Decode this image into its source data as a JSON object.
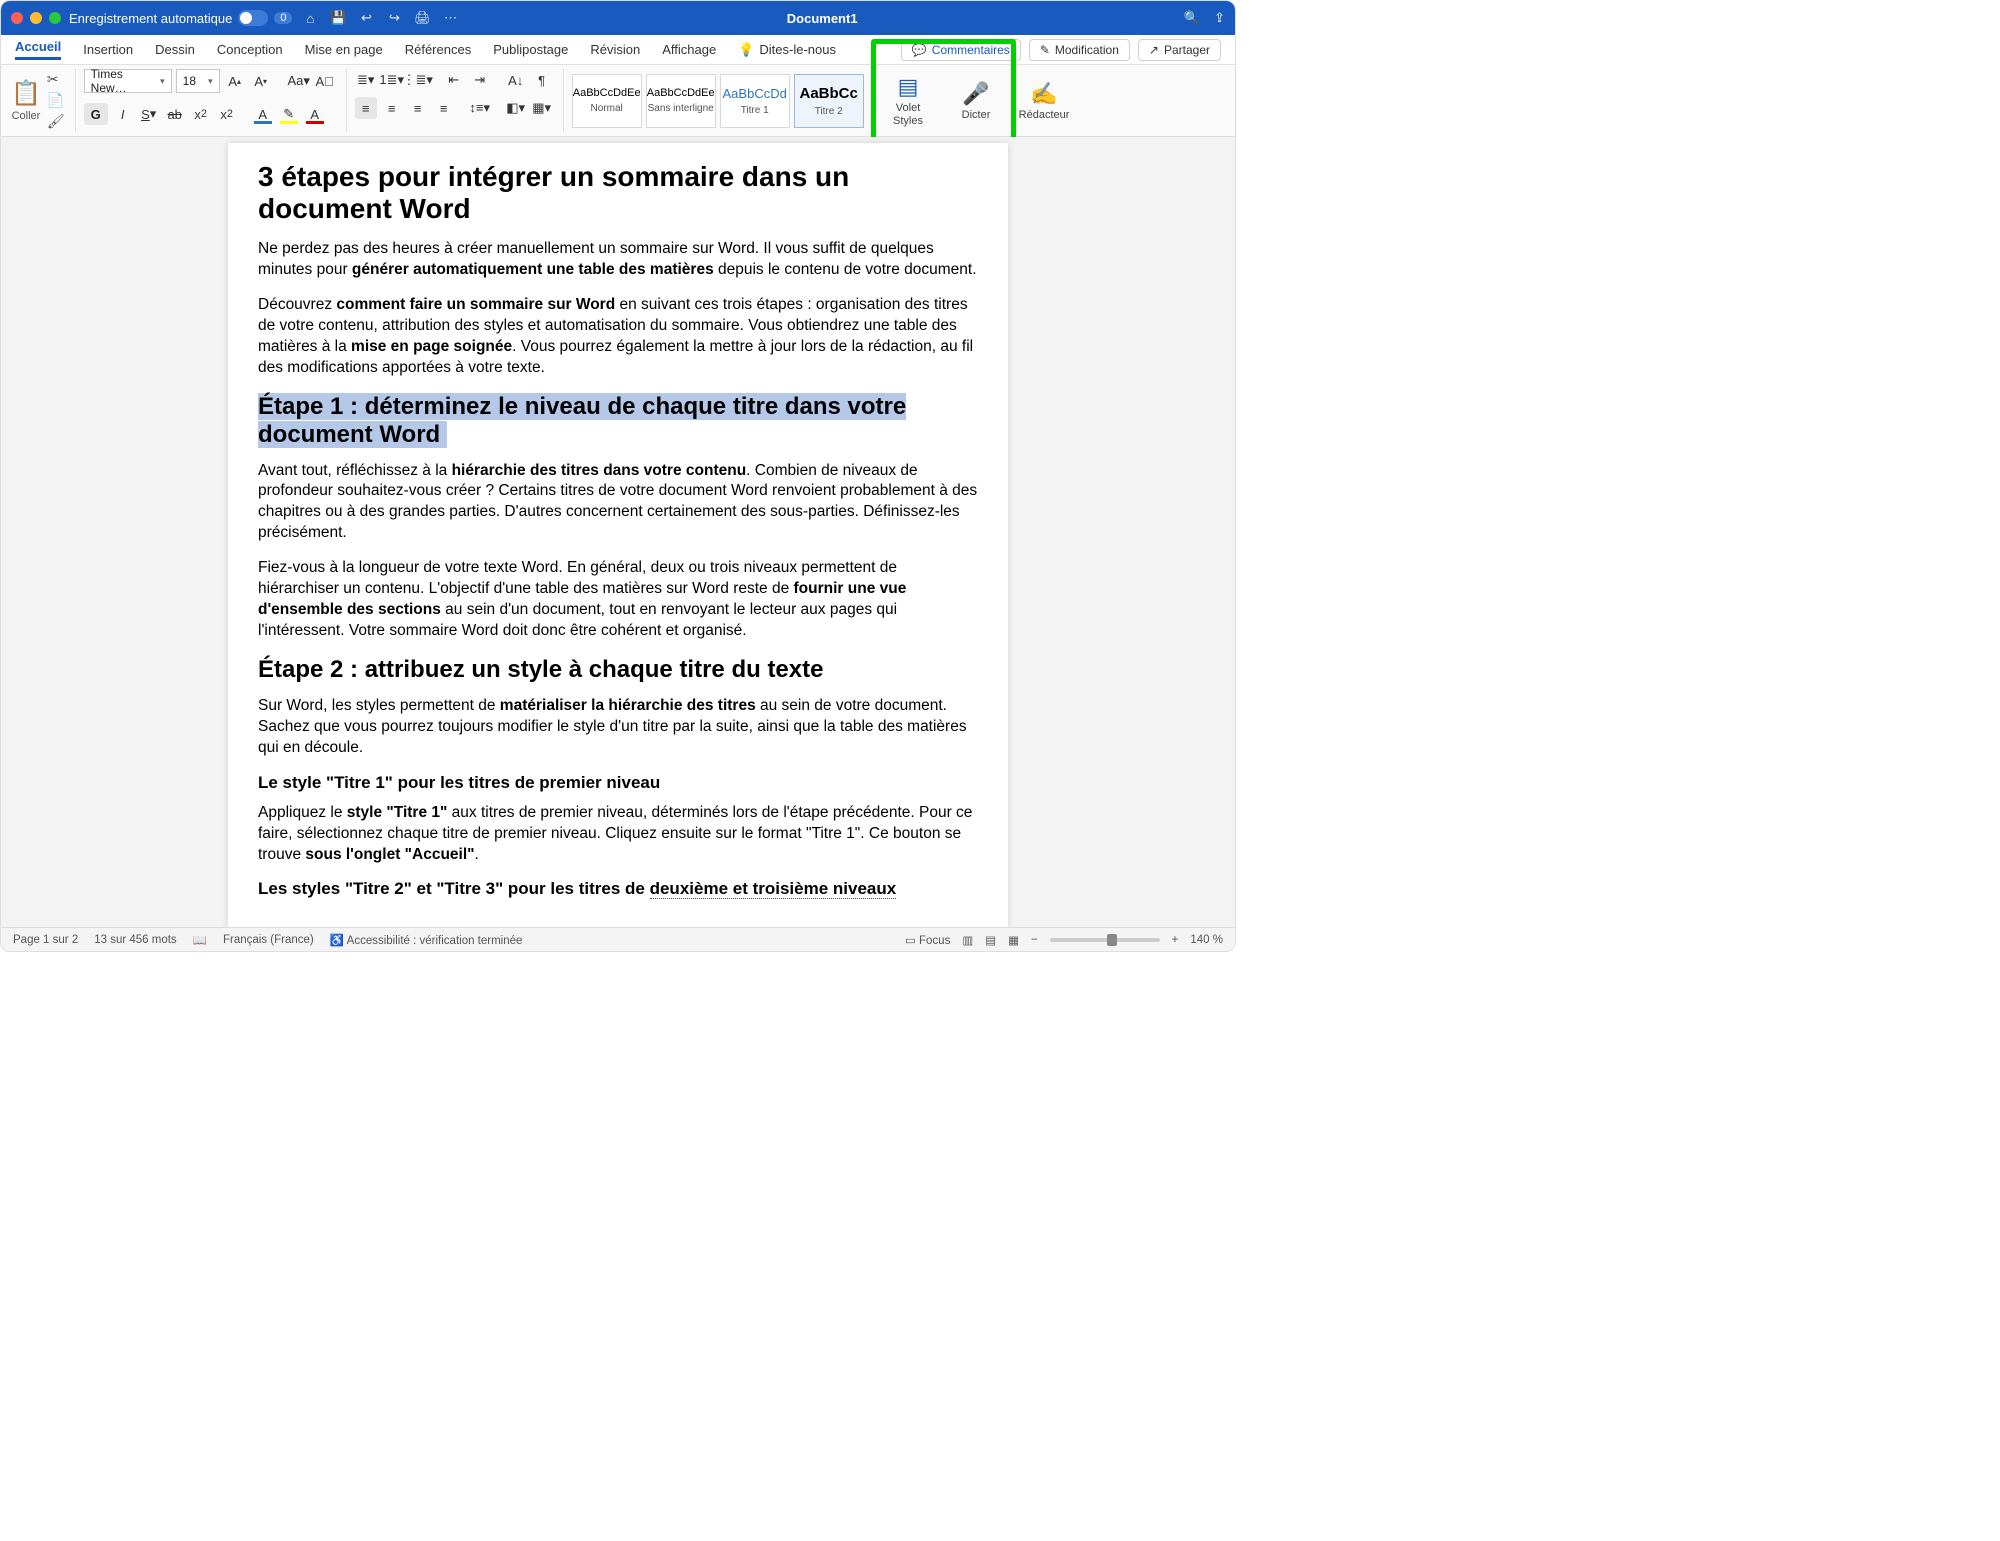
{
  "titlebar": {
    "autosave_label": "Enregistrement automatique",
    "autosave_badge": "0",
    "doc_title": "Document1"
  },
  "tabs": [
    "Accueil",
    "Insertion",
    "Dessin",
    "Conception",
    "Mise en page",
    "Références",
    "Publipostage",
    "Révision",
    "Affichage",
    "Dites-le-nous"
  ],
  "right_pills": {
    "comments": "Commentaires",
    "editing": "Modification",
    "share": "Partager"
  },
  "ribbon": {
    "paste_label": "Coller",
    "font_name": "Times New…",
    "font_size": "18",
    "styles": [
      {
        "preview": "AaBbCcDdEe",
        "label": "Normal"
      },
      {
        "preview": "AaBbCcDdEe",
        "label": "Sans interligne"
      },
      {
        "preview": "AaBbCcDd",
        "label": "Titre 1"
      },
      {
        "preview": "AaBbCc",
        "label": "Titre 2"
      }
    ],
    "styles_pane": "Volet Styles",
    "dictate": "Dicter",
    "editor": "Rédacteur"
  },
  "document": {
    "h1": "3 étapes pour intégrer un sommaire dans un document Word",
    "p1_a": "Ne perdez pas des heures à créer manuellement un sommaire sur Word. Il vous suffit de quelques minutes pour ",
    "p1_b": "générer automatiquement une table des matières",
    "p1_c": " depuis le contenu de votre document.",
    "p2_a": "Découvrez ",
    "p2_b": "comment faire un sommaire sur Word",
    "p2_c": " en suivant ces trois étapes : organisation des titres de votre contenu, attribution des styles et automatisation du sommaire. Vous obtiendrez une table des matières à la ",
    "p2_d": "mise en page soignée",
    "p2_e": ". Vous pourrez également la mettre à jour lors de la rédaction, au fil des modifications apportées à votre texte.",
    "h2a": "Étape 1 : déterminez le niveau de chaque titre dans votre document Word",
    "p3_a": "Avant tout, réfléchissez à la ",
    "p3_b": "hiérarchie des titres dans votre contenu",
    "p3_c": ". Combien de niveaux de profondeur souhaitez-vous créer ? Certains titres de votre document Word renvoient probablement à des chapitres ou à des grandes parties. D'autres concernent certainement des sous-parties. Définissez-les précisément.",
    "p4_a": "Fiez-vous à la longueur de votre texte Word. En général, deux ou trois niveaux permettent de hiérarchiser un contenu. L'objectif d'une table des matières sur Word reste de ",
    "p4_b": "fournir une vue d'ensemble des sections",
    "p4_c": " au sein d'un document, tout en renvoyant le lecteur aux pages qui l'intéressent. Votre sommaire Word doit donc être cohérent et organisé.",
    "h2b": "Étape 2 : attribuez un style à chaque titre du texte",
    "p5_a": "Sur Word, les styles permettent de ",
    "p5_b": "matérialiser la hiérarchie des titres",
    "p5_c": " au sein de votre document. Sachez que vous pourrez toujours modifier le style d'un titre par la suite, ainsi que la table des matières qui en découle.",
    "h3a": "Le style \"Titre 1\" pour les titres de premier niveau",
    "p6_a": "Appliquez le ",
    "p6_b": "style \"Titre 1\"",
    "p6_c": " aux titres de premier niveau, déterminés lors de l'étape précédente. Pour ce faire, sélectionnez chaque titre de premier niveau. Cliquez ensuite sur le format \"Titre 1\". Ce bouton se trouve ",
    "p6_d": "sous l'onglet \"Accueil\"",
    "p6_e": ".",
    "h3b_a": "Les styles \"Titre 2\" et \"Titre 3\" pour les titres de ",
    "h3b_b": "deuxième et troisième niveaux"
  },
  "status": {
    "page": "Page 1 sur 2",
    "words": "13 sur 456 mots",
    "lang": "Français (France)",
    "a11y": "Accessibilité : vérification terminée",
    "focus": "Focus",
    "zoom": "140 %"
  }
}
